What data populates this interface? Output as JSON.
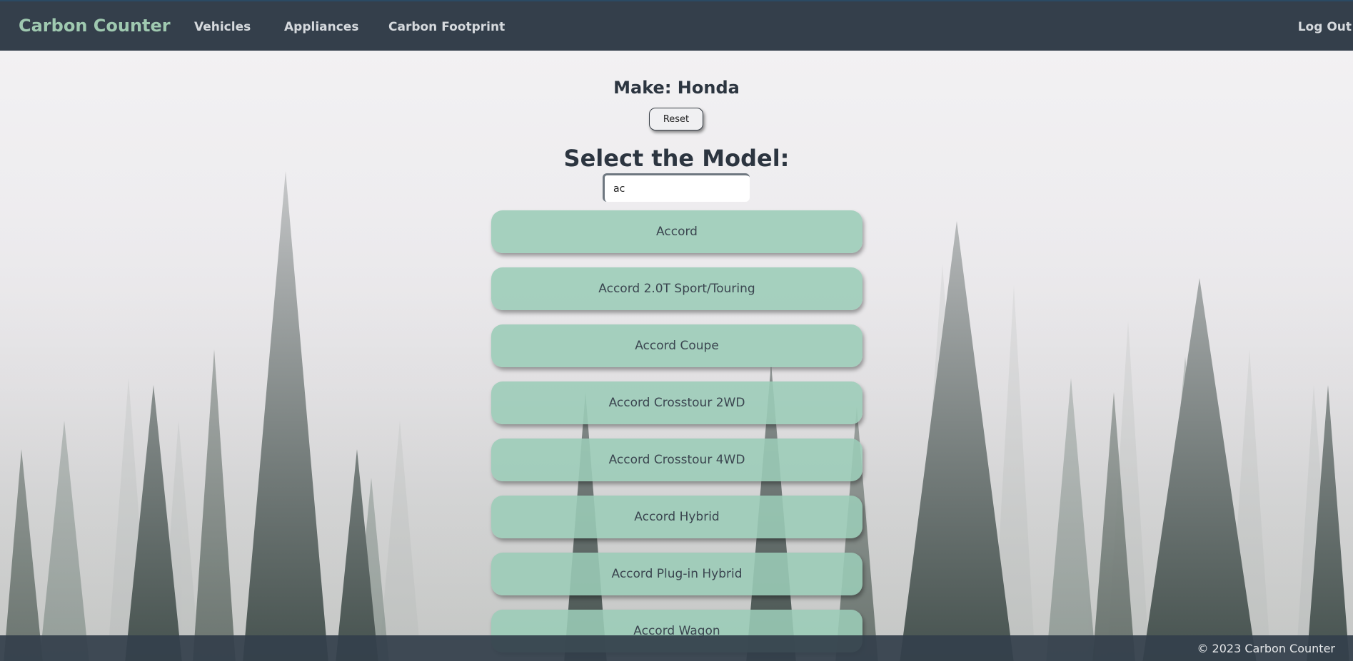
{
  "nav": {
    "brand": "Carbon Counter",
    "links": [
      "Vehicles",
      "Appliances",
      "Carbon Footprint"
    ],
    "logout": "Log Out"
  },
  "main": {
    "make_title": "Make: Honda",
    "reset_label": "Reset",
    "select_title": "Select the Model:",
    "search_value": "ac",
    "models": [
      "Accord",
      "Accord 2.0T Sport/Touring",
      "Accord Coupe",
      "Accord Crosstour 2WD",
      "Accord Crosstour 4WD",
      "Accord Hybrid",
      "Accord Plug-in Hybrid",
      "Accord Wagon"
    ]
  },
  "footer": {
    "text": "© 2023 Carbon Counter"
  },
  "colors": {
    "navbar": "#343f4b",
    "brand": "#9fc9b0",
    "model_button": "#9bccb7",
    "text_dark": "#2c3540"
  }
}
